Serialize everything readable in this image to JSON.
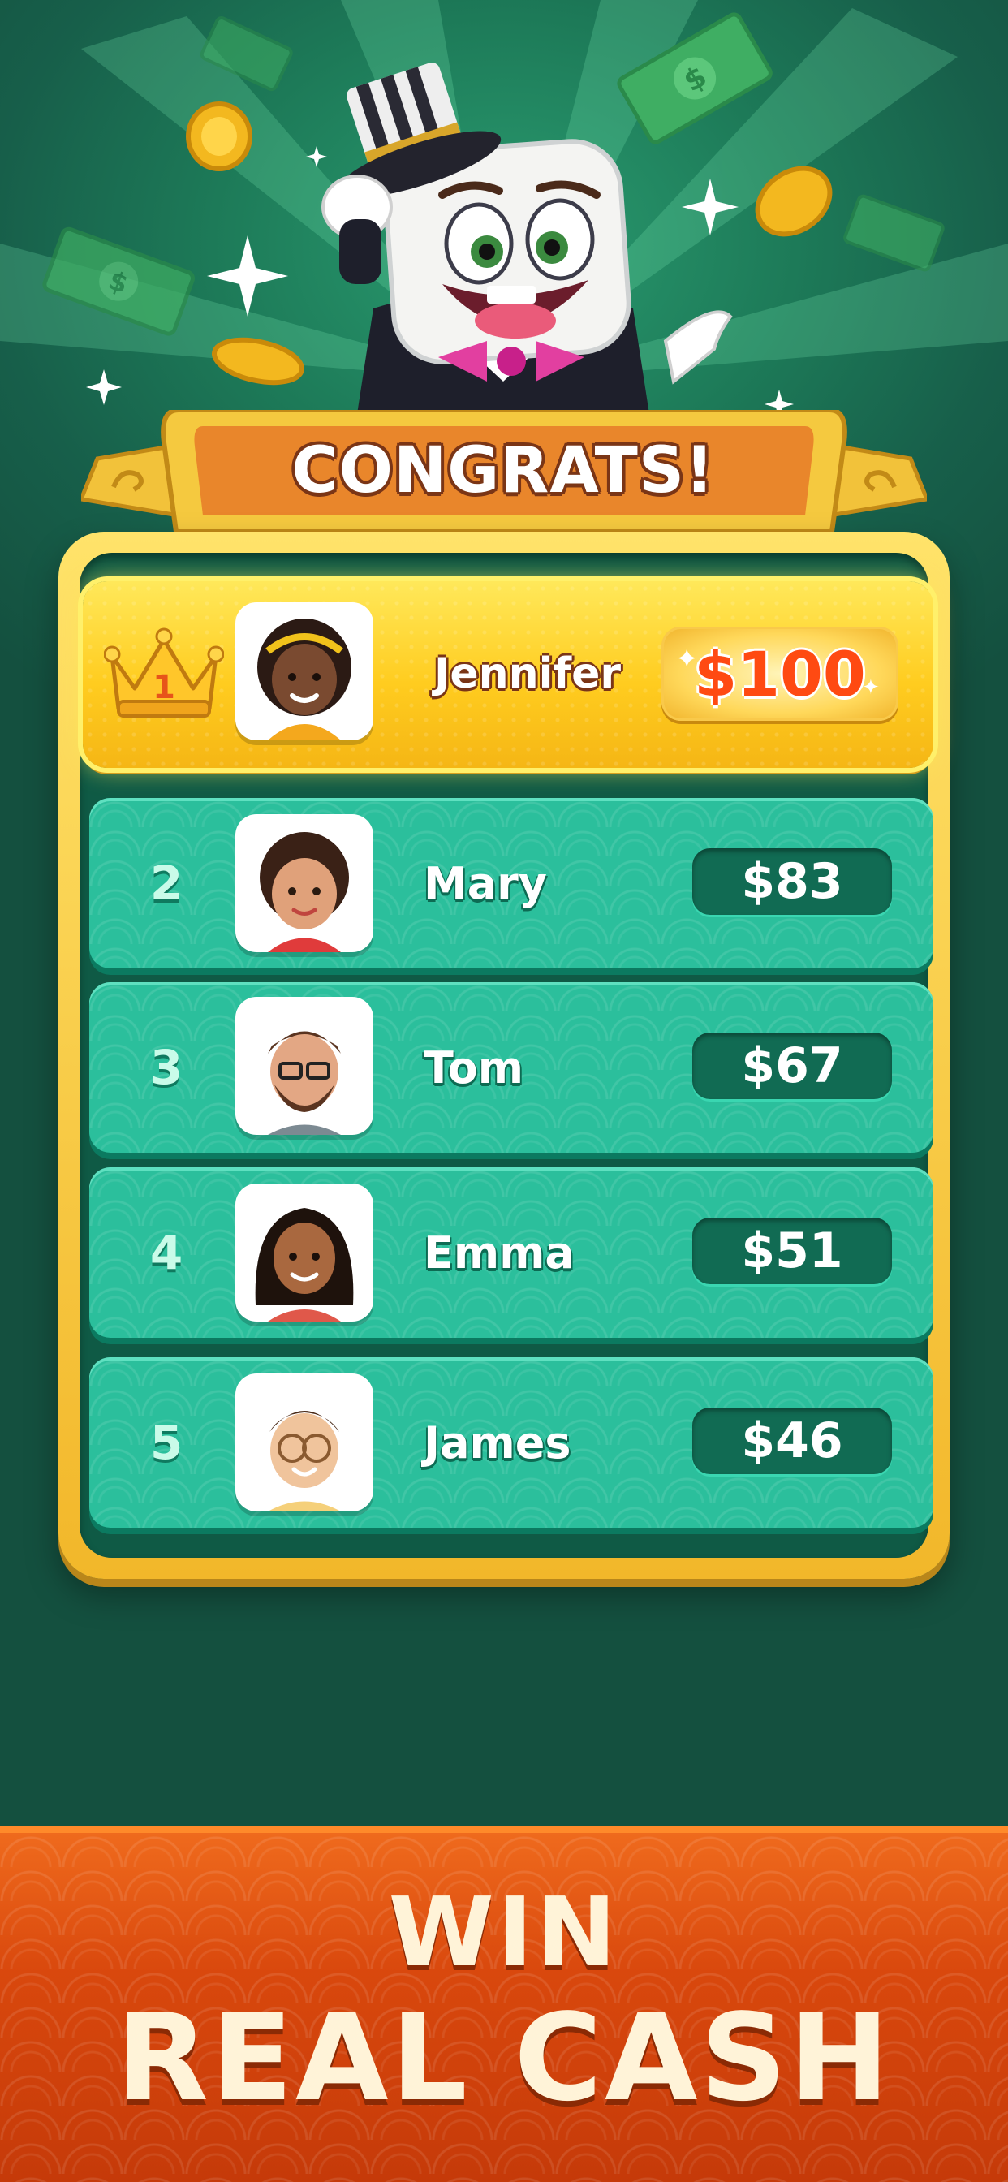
{
  "header": {
    "title": "CONGRATS!"
  },
  "winner": {
    "rank": "1",
    "name": "Jennifer",
    "prize": "$100"
  },
  "leaderboard": [
    {
      "rank": "2",
      "name": "Mary",
      "prize": "$83"
    },
    {
      "rank": "3",
      "name": "Tom",
      "prize": "$67"
    },
    {
      "rank": "4",
      "name": "Emma",
      "prize": "$51"
    },
    {
      "rank": "5",
      "name": "James",
      "prize": "$46"
    }
  ],
  "tagline": {
    "line1": "WIN",
    "line2": "REAL CASH"
  },
  "icons": [
    "mascot-sugar-cube-top-hat",
    "gold-coin-icon",
    "dollar-bill-icon",
    "sparkle-icon",
    "crown-icon"
  ],
  "colors": {
    "background": "#1d7a58",
    "gold": "#ffcc1f",
    "row": "#2bbf9c",
    "prize_red": "#ff4a12",
    "banner": "#d9480d"
  }
}
